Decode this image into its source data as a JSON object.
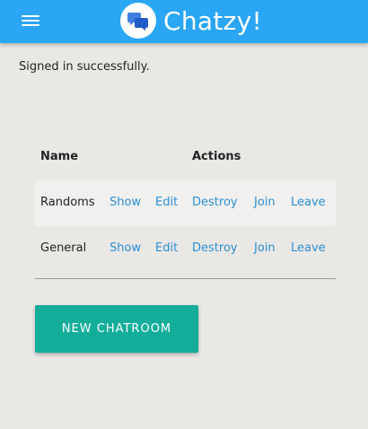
{
  "navbar": {
    "menu_icon": "hamburger-icon",
    "brand_icon": "chat-bubbles-icon",
    "brand_name": "Chatzy!",
    "color": "#2aa6f5"
  },
  "flash": {
    "message": "Signed in successfully."
  },
  "table": {
    "headers": {
      "name": "Name",
      "actions": "Actions"
    },
    "rows": [
      {
        "name": "Randoms",
        "show": "Show",
        "edit": "Edit",
        "destroy": "Destroy",
        "join": "Join",
        "leave": "Leave"
      },
      {
        "name": "General",
        "show": "Show",
        "edit": "Edit",
        "destroy": "Destroy",
        "join": "Join",
        "leave": "Leave"
      }
    ],
    "link_color": "#2a8fd8"
  },
  "new_chatroom_button": {
    "label": "NEW CHATROOM",
    "color": "#13ad9a"
  }
}
